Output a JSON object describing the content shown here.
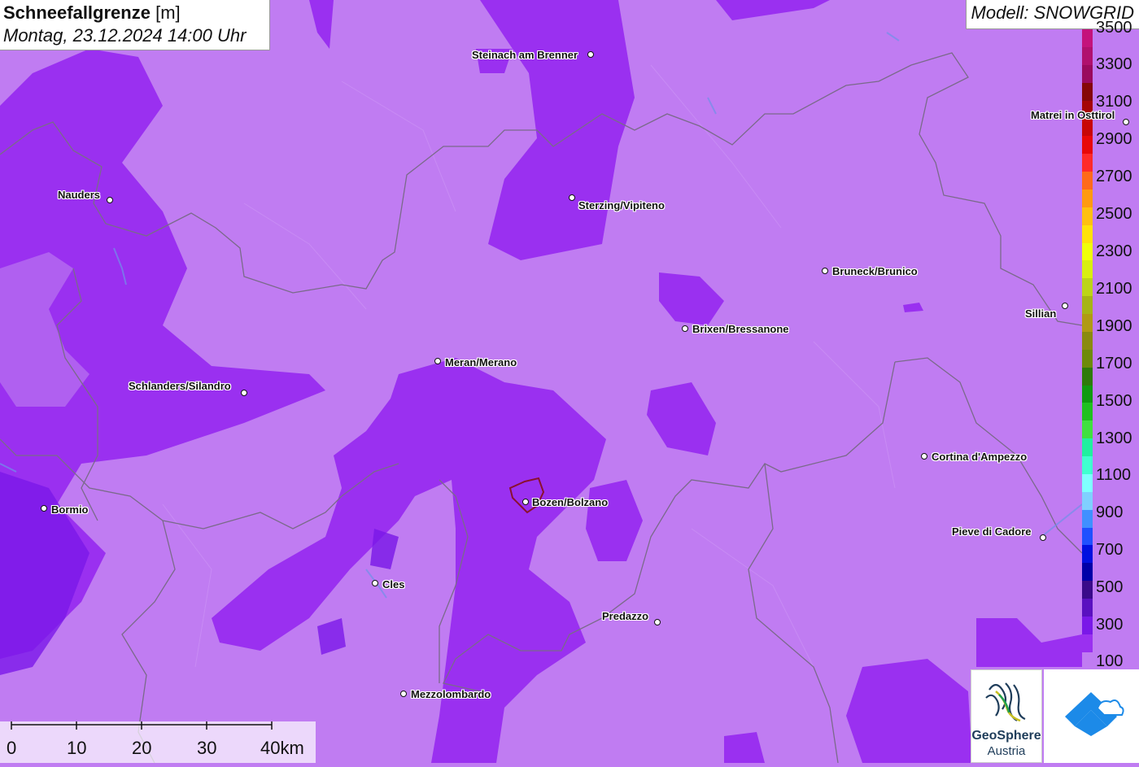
{
  "title": {
    "variable": "Schneefallgrenze",
    "unit": "[m]",
    "datetime": "Montag, 23.12.2024 14:00 Uhr"
  },
  "model": "Modell: SNOWGRID",
  "legend": {
    "labels": [
      "3300",
      "3100",
      "2900",
      "2700",
      "2500",
      "2300",
      "2100",
      "1900",
      "1700",
      "1500",
      "1300",
      "1100",
      "900",
      "700",
      "500",
      "300",
      "100"
    ],
    "top_partial_label": "3500",
    "colors": [
      "#c4127c",
      "#b0106e",
      "#9a0a5e",
      "#850707",
      "#a50505",
      "#c80606",
      "#e80808",
      "#ff2a2a",
      "#ff6a1a",
      "#ff9a10",
      "#ffc010",
      "#ffe20a",
      "#f0ff0a",
      "#d8ef10",
      "#bcd418",
      "#a6b416",
      "#b09a14",
      "#8a8a10",
      "#6e8a0a",
      "#2e7a0a",
      "#109a10",
      "#20c020",
      "#40e040",
      "#20f0a0",
      "#40ffd0",
      "#80ffff",
      "#80d0ff",
      "#4090ff",
      "#2050ff",
      "#0010e0",
      "#0000a8",
      "#3a0a8a",
      "#5a10c0",
      "#7a18e8",
      "#9a30f0",
      "#c07cf2"
    ]
  },
  "cities": [
    {
      "name": "Steinach am Brenner"
    },
    {
      "name": "Nauders"
    },
    {
      "name": "Sterzing/Vipiteno"
    },
    {
      "name": "Matrei in Osttirol"
    },
    {
      "name": "Bruneck/Brunico"
    },
    {
      "name": "Sillian"
    },
    {
      "name": "Brixen/Bressanone"
    },
    {
      "name": "Meran/Merano"
    },
    {
      "name": "Schlanders/Silandro"
    },
    {
      "name": "Cortina d'Ampezzo"
    },
    {
      "name": "Bormio"
    },
    {
      "name": "Bozen/Bolzano"
    },
    {
      "name": "Pieve di Cadore"
    },
    {
      "name": "Cles"
    },
    {
      "name": "Predazzo"
    },
    {
      "name": "Mezzolombardo"
    }
  ],
  "scale": {
    "ticks": [
      "0",
      "10",
      "20",
      "30",
      "40km"
    ]
  },
  "logos": {
    "geosphere_line1": "GeoSphere",
    "geosphere_line2": "Austria"
  },
  "colors": {
    "snowline_high": "#c07cf2",
    "snowline_low": "#9a30f0",
    "snowline_lowest": "#7a18e8",
    "border": "#7a6a8a",
    "bolzano_outline": "#8a1030"
  }
}
